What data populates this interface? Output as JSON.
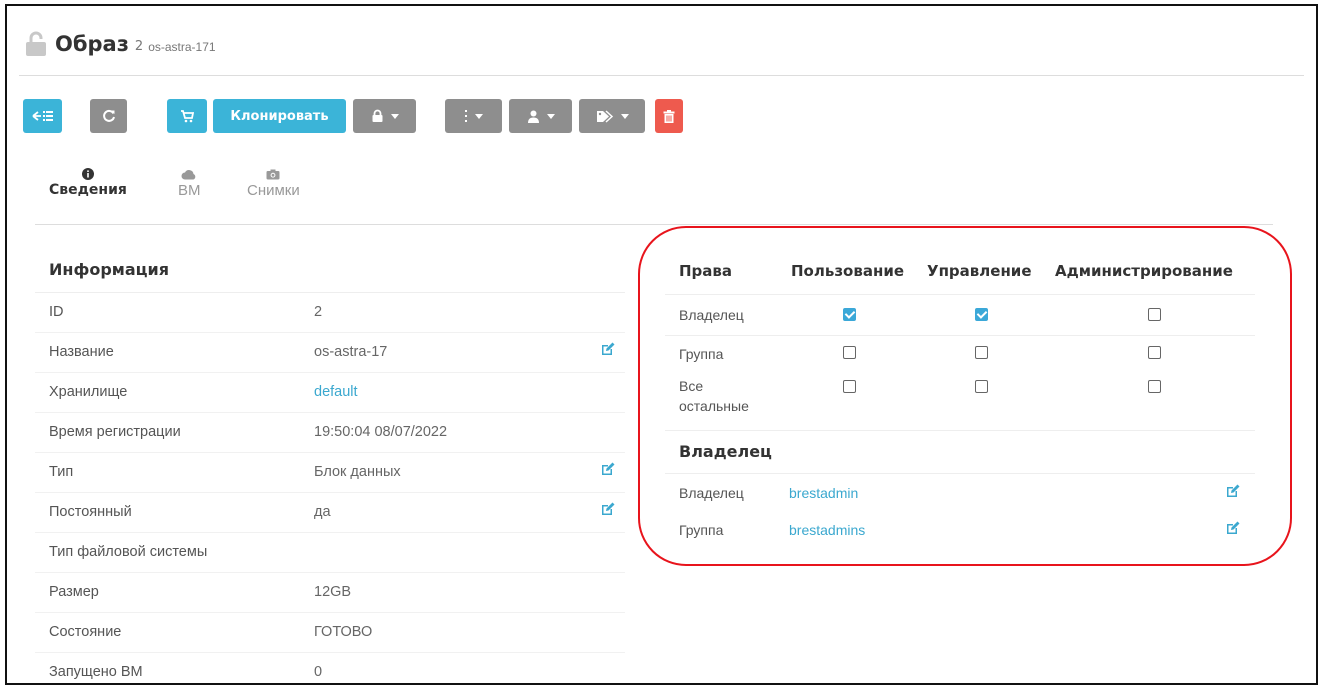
{
  "header": {
    "title": "Образ",
    "id": "2",
    "name": "os-astra-171"
  },
  "toolbar": {
    "clone_label": "Клонировать"
  },
  "tabs": [
    {
      "label": "Сведения",
      "icon": "info-icon"
    },
    {
      "label": "ВМ",
      "icon": "cloud-icon"
    },
    {
      "label": "Снимки",
      "icon": "camera-icon"
    }
  ],
  "info": {
    "title": "Информация",
    "rows": [
      {
        "label": "ID",
        "value": "2"
      },
      {
        "label": "Название",
        "value": "os-astra-17"
      },
      {
        "label": "Хранилище",
        "value": "default"
      },
      {
        "label": "Время регистрации",
        "value": "19:50:04 08/07/2022"
      },
      {
        "label": "Тип",
        "value": "Блок данных"
      },
      {
        "label": "Постоянный",
        "value": "да"
      },
      {
        "label": "Тип файловой системы",
        "value": ""
      },
      {
        "label": "Размер",
        "value": "12GB"
      },
      {
        "label": "Состояние",
        "value": "ГОТОВО"
      },
      {
        "label": "Запущено ВМ",
        "value": "0"
      }
    ]
  },
  "permissions": {
    "header": {
      "rights": "Права",
      "use": "Пользование",
      "manage": "Управление",
      "admin": "Администрирование"
    },
    "rows": [
      {
        "label": "Владелец",
        "use": true,
        "manage": true,
        "admin": false
      },
      {
        "label": "Группа",
        "use": false,
        "manage": false,
        "admin": false
      },
      {
        "label_line1": "Все",
        "label_line2": "остальные",
        "use": false,
        "manage": false,
        "admin": false
      }
    ]
  },
  "ownership": {
    "title": "Владелец",
    "owner_label": "Владелец",
    "owner_value": "brestadmin",
    "group_label": "Группа",
    "group_value": "brestadmins"
  },
  "colors": {
    "info": "#3bb4d8",
    "gray": "#8e8e8e",
    "danger": "#ee5a4e",
    "link": "#3ba8cf",
    "highlight": "#e8141c"
  }
}
